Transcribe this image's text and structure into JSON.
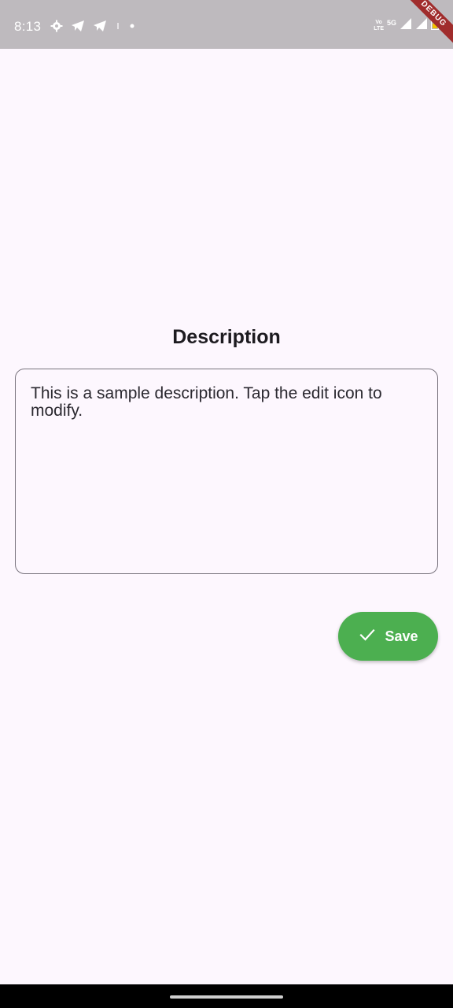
{
  "status_bar": {
    "time": "8:13",
    "left_icons": [
      "gear-icon",
      "telegram-icon",
      "telegram-icon",
      "small-dot-icon",
      "dot-icon"
    ],
    "volte_line1": "Vo",
    "volte_line2": "LTE",
    "network_type": "5G",
    "debug_label": "DEBUG"
  },
  "main": {
    "title": "Description",
    "description_text": "This is a sample description. Tap the edit icon to modify."
  },
  "actions": {
    "save_label": "Save",
    "save_icon": "check-icon",
    "save_color": "#4caf50"
  }
}
